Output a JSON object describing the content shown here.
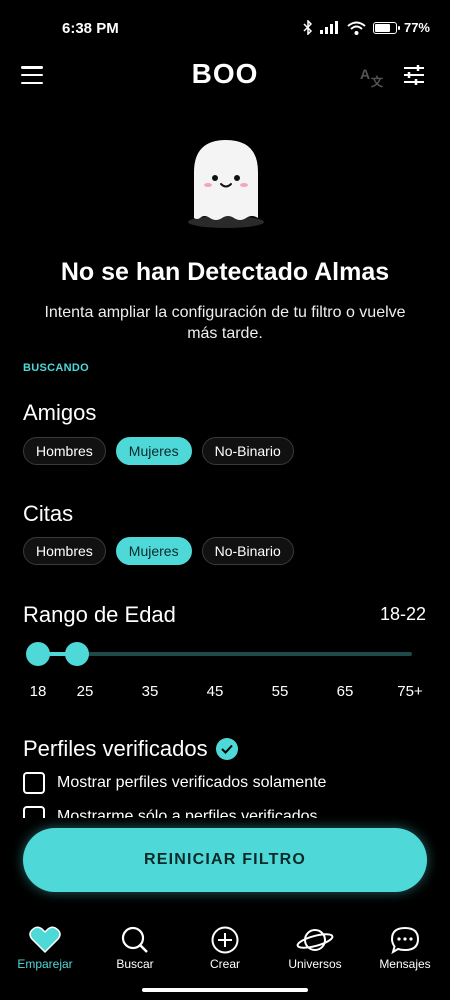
{
  "status_bar": {
    "time": "6:38 PM",
    "battery": "77%",
    "battery_level": 0.77,
    "icons": [
      "bluetooth-icon",
      "signal-icon",
      "wifi-icon",
      "battery-icon"
    ]
  },
  "header": {
    "title": "BOO",
    "icons": [
      "menu-icon",
      "translate-icon",
      "filter-icon"
    ]
  },
  "empty_state": {
    "title": "No se han Detectado Almas",
    "subtitle": "Intenta ampliar la configuración de tu filtro o vuelve más tarde."
  },
  "searching_label": "BUSCANDO",
  "friends": {
    "title": "Amigos",
    "options": [
      {
        "label": "Hombres",
        "selected": false
      },
      {
        "label": "Mujeres",
        "selected": true
      },
      {
        "label": "No-Binario",
        "selected": false
      }
    ]
  },
  "dates": {
    "title": "Citas",
    "options": [
      {
        "label": "Hombres",
        "selected": false
      },
      {
        "label": "Mujeres",
        "selected": true
      },
      {
        "label": "No-Binario",
        "selected": false
      }
    ]
  },
  "age_range": {
    "title": "Rango de Edad",
    "value": "18-22",
    "min": 18,
    "max": 22,
    "ticks": [
      "18",
      "25",
      "35",
      "45",
      "55",
      "65",
      "75+"
    ]
  },
  "verified": {
    "title": "Perfiles verificados",
    "option1": "Mostrar perfiles verificados solamente",
    "option2": "Mostrarme sólo a perfiles verificados"
  },
  "reset_button": "REINICIAR FILTRO",
  "colors": {
    "accent": "#4fd8d8",
    "background": "#000000"
  },
  "bottom_nav": [
    {
      "label": "Emparejar",
      "icon": "heart-icon",
      "active": true
    },
    {
      "label": "Buscar",
      "icon": "search-icon",
      "active": false
    },
    {
      "label": "Crear",
      "icon": "plus-circle-icon",
      "active": false
    },
    {
      "label": "Universos",
      "icon": "planet-icon",
      "active": false
    },
    {
      "label": "Mensajes",
      "icon": "chat-bubble-icon",
      "active": false
    }
  ]
}
